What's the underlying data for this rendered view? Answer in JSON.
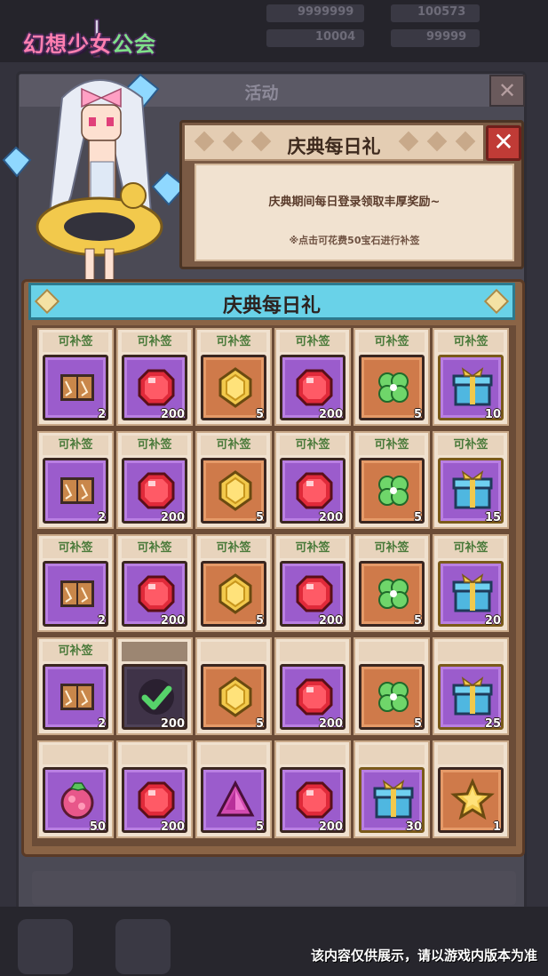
{
  "game": {
    "logo_text_pink": "幻想少女",
    "logo_text_green": "公会"
  },
  "resources": [
    {
      "name": "resource-a",
      "value": "9999999"
    },
    {
      "name": "resource-b",
      "value": "100573"
    },
    {
      "name": "resource-c",
      "value": "10004"
    },
    {
      "name": "resource-d",
      "value": "99999"
    }
  ],
  "background_panel": {
    "title": "活动",
    "close": "✕"
  },
  "info_panel": {
    "title": "庆典每日礼",
    "close": "✕",
    "description": "庆典期间每日登录领取丰厚奖励~",
    "note": "※点击可花费50宝石进行补签"
  },
  "calendar": {
    "title": "庆典每日礼",
    "makeup_label": "可补签",
    "rows": [
      [
        {
          "status": "makeup",
          "item": "book-icon",
          "bg": "purple",
          "qty": "2"
        },
        {
          "status": "makeup",
          "item": "red-gem-icon",
          "bg": "purple",
          "qty": "200"
        },
        {
          "status": "makeup",
          "item": "gold-coin-icon",
          "bg": "orange",
          "qty": "5"
        },
        {
          "status": "makeup",
          "item": "red-gem-icon",
          "bg": "purple",
          "qty": "200"
        },
        {
          "status": "makeup",
          "item": "clover-icon",
          "bg": "orange",
          "qty": "5"
        },
        {
          "status": "makeup",
          "item": "gift-box-icon",
          "bg": "purple",
          "qty": "10"
        }
      ],
      [
        {
          "status": "makeup",
          "item": "book-icon",
          "bg": "purple",
          "qty": "2"
        },
        {
          "status": "makeup",
          "item": "red-gem-icon",
          "bg": "purple",
          "qty": "200"
        },
        {
          "status": "makeup",
          "item": "gold-coin-icon",
          "bg": "orange",
          "qty": "5"
        },
        {
          "status": "makeup",
          "item": "red-gem-icon",
          "bg": "purple",
          "qty": "200"
        },
        {
          "status": "makeup",
          "item": "clover-icon",
          "bg": "orange",
          "qty": "5"
        },
        {
          "status": "makeup",
          "item": "gift-box-icon",
          "bg": "purple",
          "qty": "15"
        }
      ],
      [
        {
          "status": "makeup",
          "item": "book-icon",
          "bg": "purple",
          "qty": "2"
        },
        {
          "status": "makeup",
          "item": "red-gem-icon",
          "bg": "purple",
          "qty": "200"
        },
        {
          "status": "makeup",
          "item": "gold-coin-icon",
          "bg": "orange",
          "qty": "5"
        },
        {
          "status": "makeup",
          "item": "red-gem-icon",
          "bg": "purple",
          "qty": "200"
        },
        {
          "status": "makeup",
          "item": "clover-icon",
          "bg": "orange",
          "qty": "5"
        },
        {
          "status": "makeup",
          "item": "gift-box-icon",
          "bg": "purple",
          "qty": "20"
        }
      ],
      [
        {
          "status": "makeup",
          "item": "book-icon",
          "bg": "purple",
          "qty": "2"
        },
        {
          "status": "claimed",
          "item": "checkmark-icon",
          "bg": "dark",
          "qty": "200"
        },
        {
          "status": "locked",
          "item": "gold-coin-icon",
          "bg": "orange",
          "qty": "5"
        },
        {
          "status": "locked",
          "item": "red-gem-icon",
          "bg": "purple",
          "qty": "200"
        },
        {
          "status": "locked",
          "item": "clover-icon",
          "bg": "orange",
          "qty": "5"
        },
        {
          "status": "locked",
          "item": "gift-box-icon",
          "bg": "purple",
          "qty": "25"
        }
      ],
      [
        {
          "status": "locked",
          "item": "berry-icon",
          "bg": "purple",
          "qty": "50"
        },
        {
          "status": "locked",
          "item": "red-gem-icon",
          "bg": "purple",
          "qty": "200"
        },
        {
          "status": "locked",
          "item": "pink-crystal-icon",
          "bg": "purple",
          "qty": "5"
        },
        {
          "status": "locked",
          "item": "red-gem-icon",
          "bg": "purple",
          "qty": "200"
        },
        {
          "status": "locked",
          "item": "gift-box-icon",
          "bg": "purple",
          "qty": "30"
        },
        {
          "status": "locked",
          "item": "star-icon",
          "bg": "orange",
          "qty": "1"
        }
      ]
    ]
  },
  "footer": {
    "disclaimer": "该内容仅供展示，请以游戏内版本为准"
  },
  "colors": {
    "makeup_text": "#4a7a3a",
    "header_cyan": "#69d2e8",
    "close_red": "#c03b36"
  }
}
